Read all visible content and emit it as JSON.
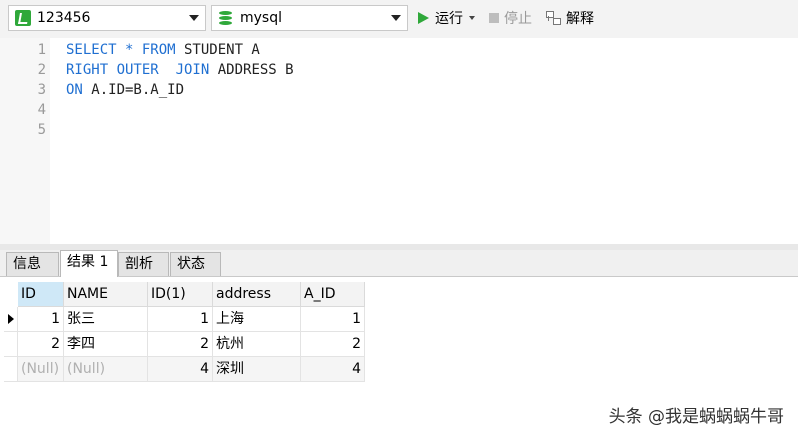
{
  "toolbar": {
    "connection": "123456",
    "database": "mysql",
    "run_label": "运行",
    "stop_label": "停止",
    "explain_label": "解释",
    "icons": {
      "connection": "connection-icon",
      "database": "database-icon",
      "run": "play-icon",
      "stop": "stop-icon",
      "explain": "explain-icon"
    },
    "colors": {
      "accent": "#2fa83a",
      "keyword": "#1f6fd1"
    }
  },
  "editor": {
    "lines": [
      {
        "num": "1",
        "tokens": [
          [
            "kw",
            "SELECT * FROM"
          ],
          [
            "id",
            " STUDENT A"
          ]
        ]
      },
      {
        "num": "2",
        "tokens": [
          [
            "kw",
            "RIGHT OUTER  JOIN"
          ],
          [
            "id",
            " ADDRESS B"
          ]
        ]
      },
      {
        "num": "3",
        "tokens": [
          [
            "kw",
            "ON"
          ],
          [
            "id",
            " A.ID=B.A_ID"
          ]
        ]
      },
      {
        "num": "4",
        "tokens": []
      },
      {
        "num": "5",
        "tokens": []
      }
    ]
  },
  "tabs": [
    {
      "label": "信息",
      "active": false
    },
    {
      "label": "结果 1",
      "active": true
    },
    {
      "label": "剖析",
      "active": false
    },
    {
      "label": "状态",
      "active": false
    }
  ],
  "grid": {
    "columns": [
      "ID",
      "NAME",
      "ID(1)",
      "address",
      "A_ID"
    ],
    "rows": [
      [
        "1",
        "张三",
        "1",
        "上海",
        "1"
      ],
      [
        "2",
        "李四",
        "2",
        "杭州",
        "2"
      ],
      [
        "(Null)",
        "(Null)",
        "4",
        "深圳",
        "4"
      ]
    ]
  },
  "watermark": "头条 @我是蜗蜗蜗牛哥"
}
